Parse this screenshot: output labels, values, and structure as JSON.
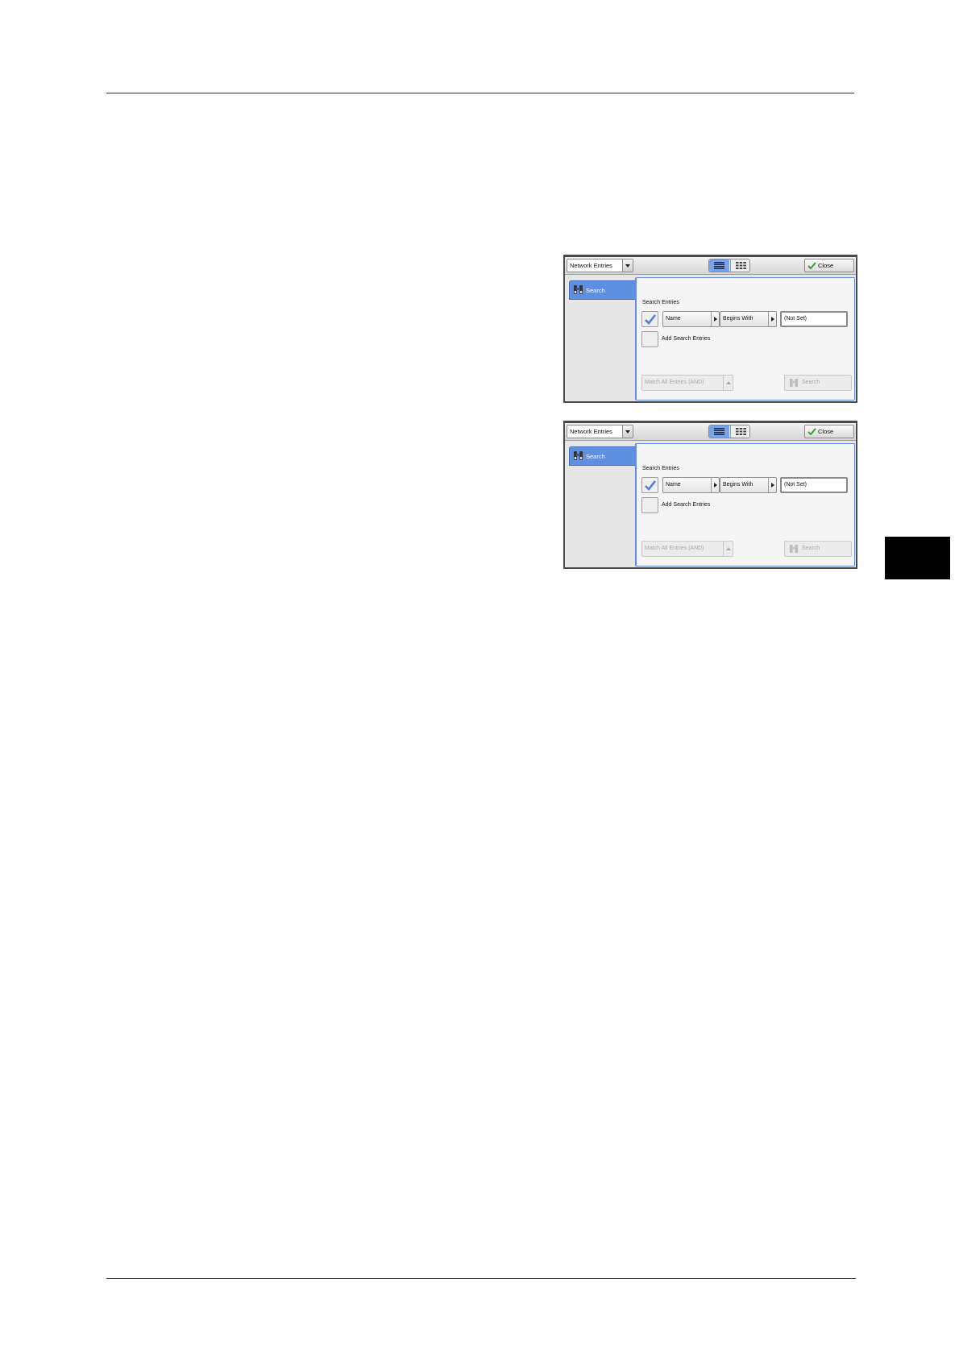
{
  "screens": [
    {
      "dropdown_value": "Network Entries",
      "close_label": "Close",
      "tab_label": "Search",
      "section_title": "Search Entries",
      "criteria_field": "Name",
      "criteria_operator": "Begins With",
      "criteria_value": "(Not Set)",
      "add_entries_label": "Add Search Entries",
      "match_mode": "Match All Entries (AND)",
      "search_button_label": "Search"
    },
    {
      "dropdown_value": "Network Entries",
      "close_label": "Close",
      "tab_label": "Search",
      "section_title": "Search Entries",
      "criteria_field": "Name",
      "criteria_operator": "Begins With",
      "criteria_value": "(Not Set)",
      "add_entries_label": "Add Search Entries",
      "match_mode": "Match All Entries (AND)",
      "search_button_label": "Search"
    }
  ],
  "icons": {
    "binoculars": "binoculars-icon",
    "check": "check-icon",
    "list_view": "list-view-icon",
    "grid_view": "grid-view-icon"
  },
  "colors": {
    "accent": "#5f8fe0",
    "chapter_tab": "#000000"
  }
}
